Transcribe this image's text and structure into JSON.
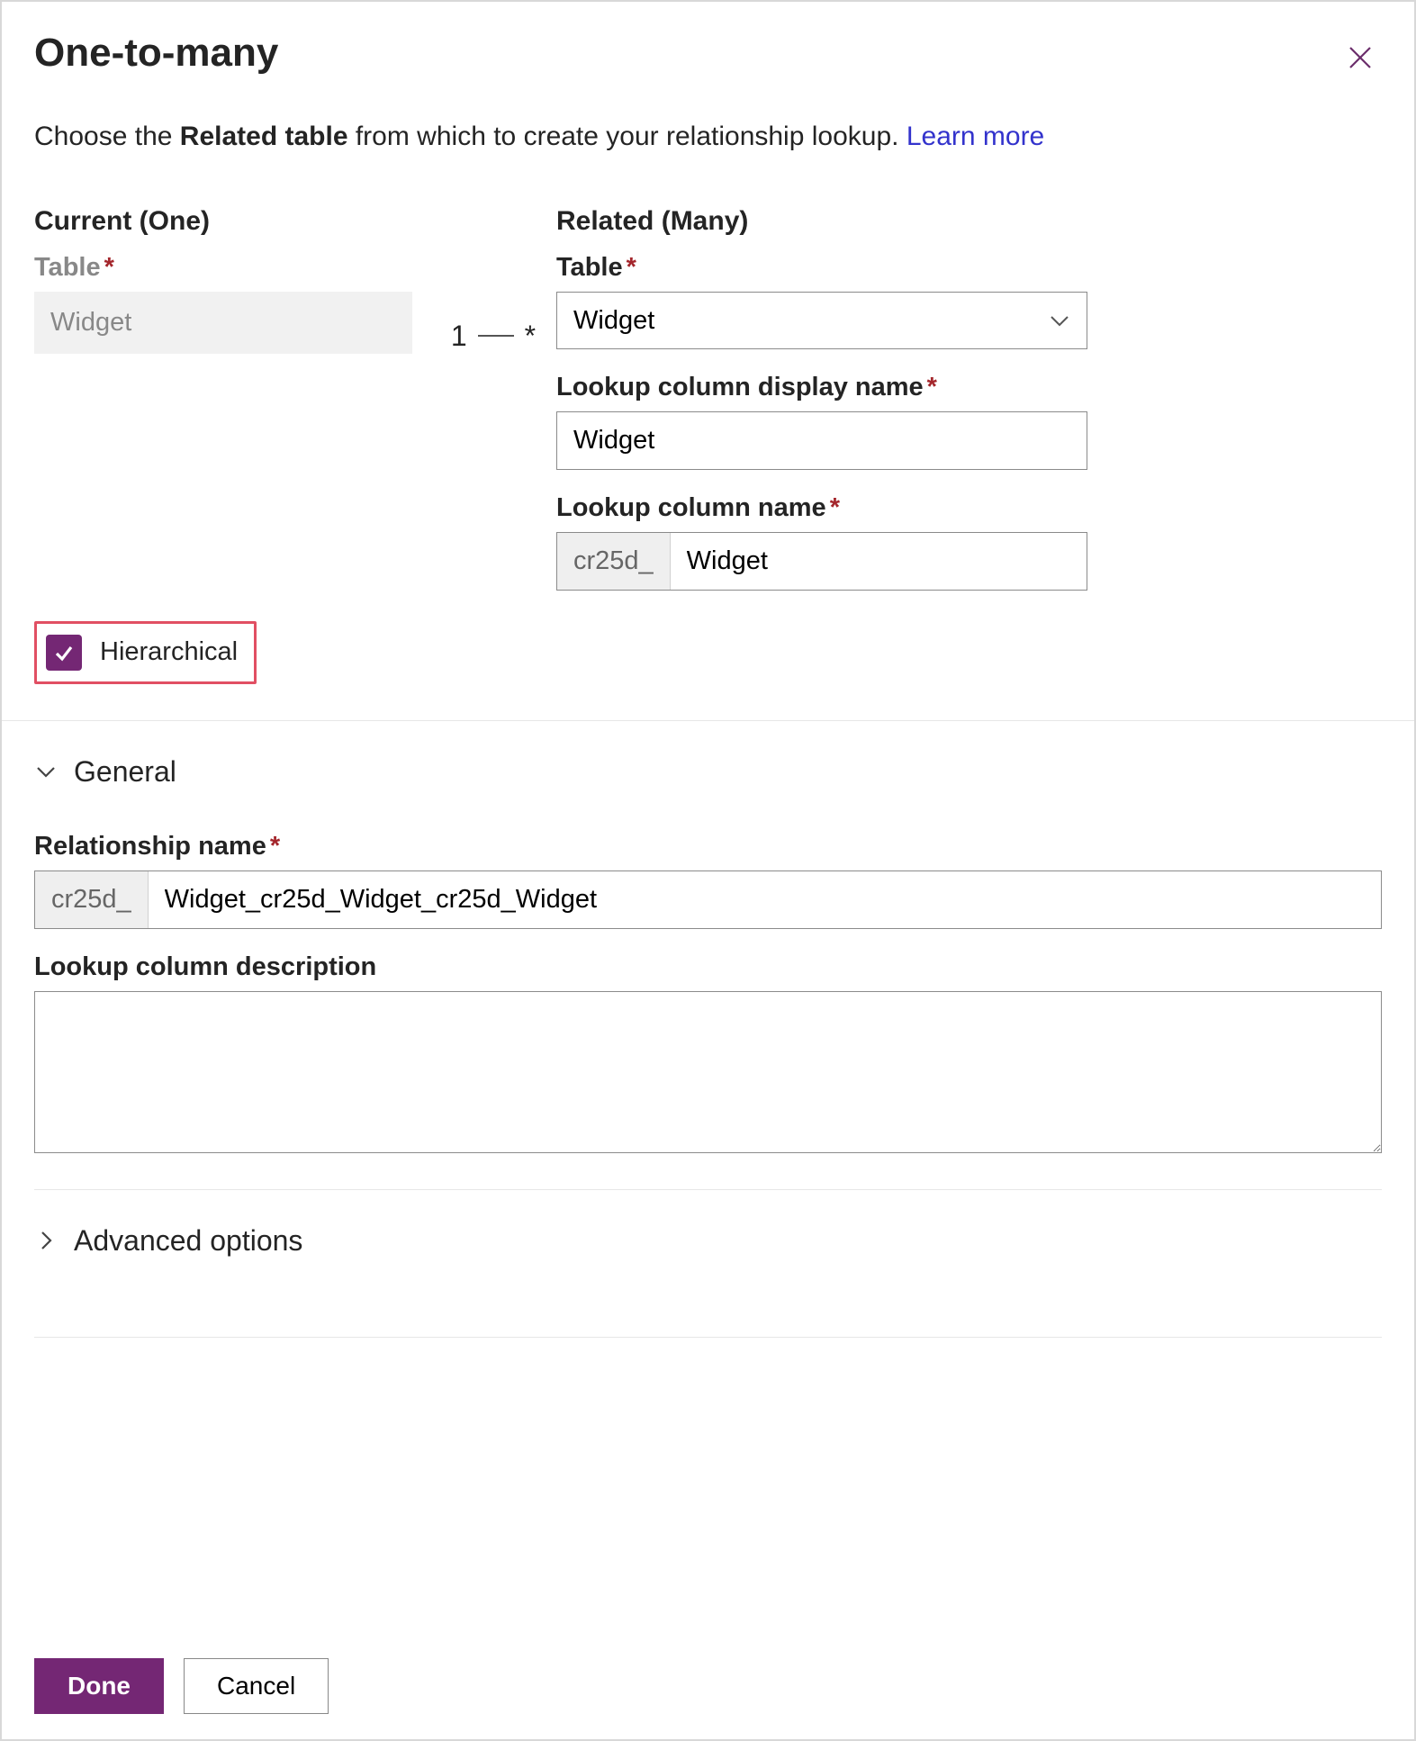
{
  "header": {
    "title": "One-to-many"
  },
  "intro": {
    "prefix": "Choose the ",
    "bold": "Related table",
    "suffix": " from which to create your relationship lookup. ",
    "link": "Learn more"
  },
  "current": {
    "heading": "Current (One)",
    "table_label": "Table",
    "table_value": "Widget"
  },
  "connector": {
    "one": "1",
    "many": "*"
  },
  "related": {
    "heading": "Related (Many)",
    "table_label": "Table",
    "table_value": "Widget",
    "display_label": "Lookup column display name",
    "display_value": "Widget",
    "name_label": "Lookup column name",
    "name_prefix": "cr25d_",
    "name_value": "Widget"
  },
  "hierarchical": {
    "label": "Hierarchical",
    "checked": true
  },
  "sections": {
    "general": "General",
    "advanced": "Advanced options"
  },
  "general": {
    "rel_label": "Relationship name",
    "rel_prefix": "cr25d_",
    "rel_value": "Widget_cr25d_Widget_cr25d_Widget",
    "desc_label": "Lookup column description",
    "desc_value": ""
  },
  "footer": {
    "done": "Done",
    "cancel": "Cancel"
  }
}
